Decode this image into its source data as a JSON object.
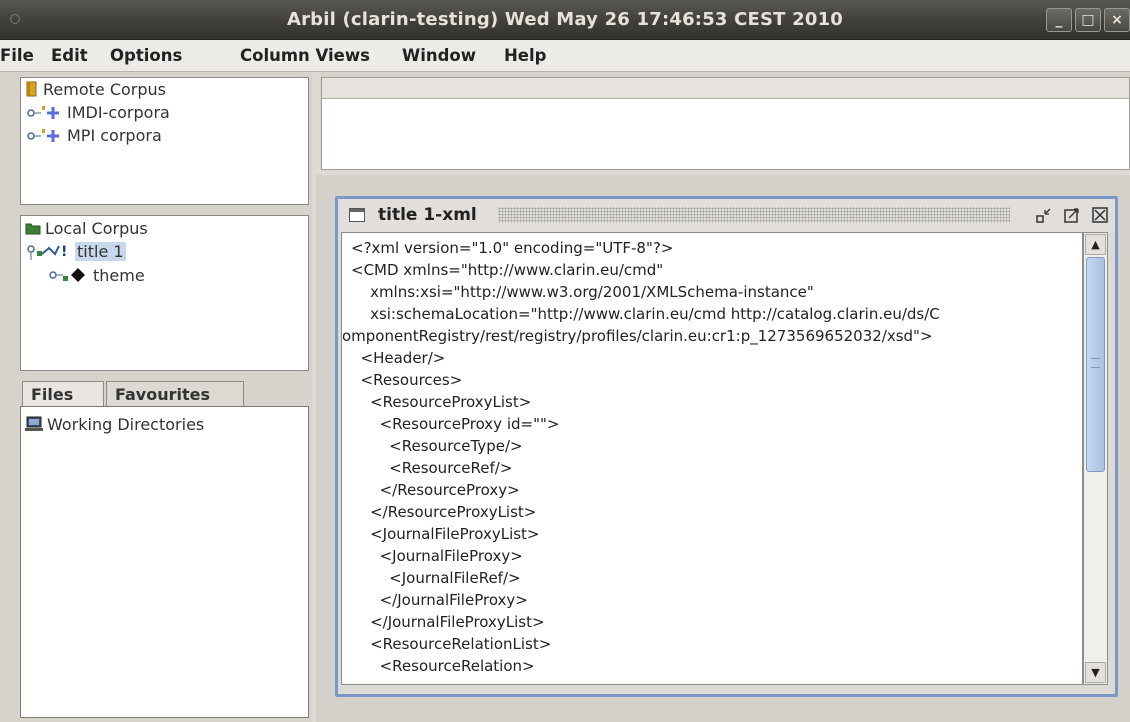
{
  "window": {
    "title": "Arbil (clarin-testing) Wed May 26 17:46:53 CEST 2010",
    "buttons": [
      "_",
      "□",
      "×"
    ]
  },
  "menubar": {
    "items": [
      "File",
      "Edit",
      "Options",
      "Column Views",
      "Window",
      "Help"
    ]
  },
  "remote_tree": {
    "root": "Remote Corpus",
    "children": [
      "IMDI-corpora",
      "MPI corpora"
    ]
  },
  "local_tree": {
    "root": "Local Corpus",
    "node": "title 1",
    "child": "theme"
  },
  "files_panel": {
    "tabs": [
      "Files",
      "Favourites"
    ],
    "active_tab": "Files",
    "items": [
      "Working Directories"
    ]
  },
  "xml_window": {
    "title": "title 1-xml",
    "lines": [
      "<?xml version=\"1.0\" encoding=\"UTF-8\"?>",
      "<CMD xmlns=\"http://www.clarin.eu/cmd\"",
      "    xmlns:xsi=\"http://www.w3.org/2001/XMLSchema-instance\"",
      "    xsi:schemaLocation=\"http://www.clarin.eu/cmd http://catalog.clarin.eu/ds/C",
      "omponentRegistry/rest/registry/profiles/clarin.eu:cr1:p_1273569652032/xsd\">",
      "  <Header/>",
      "  <Resources>",
      "    <ResourceProxyList>",
      "      <ResourceProxy id=\"\">",
      "        <ResourceType/>",
      "        <ResourceRef/>",
      "      </ResourceProxy>",
      "    </ResourceProxyList>",
      "    <JournalFileProxyList>",
      "      <JournalFileProxy>",
      "        <JournalFileRef/>",
      "      </JournalFileProxy>",
      "    </JournalFileProxyList>",
      "    <ResourceRelationList>",
      "      <ResourceRelation>"
    ]
  },
  "colors": {
    "titlebar": "#3f3d39",
    "selection": "#c8d8ec",
    "internal_frame_border": "#7a99c8"
  }
}
